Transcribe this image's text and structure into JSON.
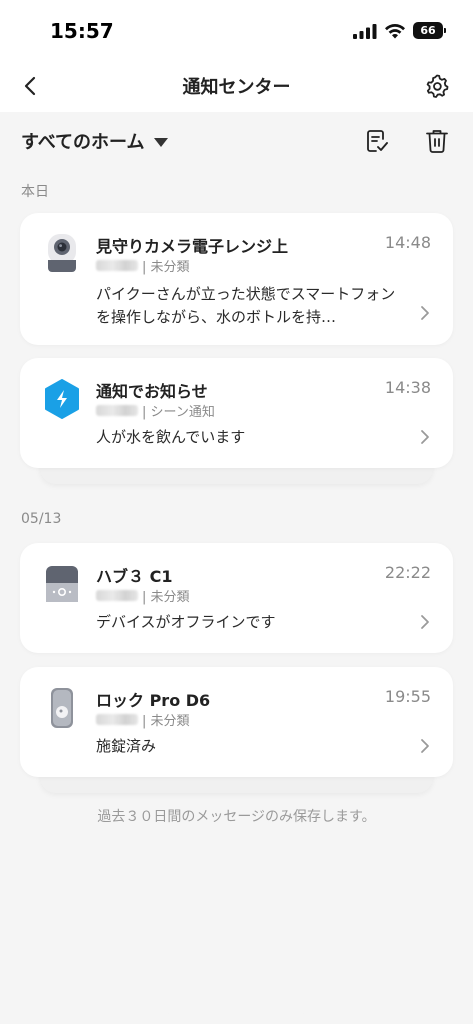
{
  "status_bar": {
    "time": "15:57",
    "battery": "66"
  },
  "nav": {
    "title": "通知センター"
  },
  "toolbar": {
    "home_filter": "すべてのホーム"
  },
  "sections": [
    {
      "label": "本日",
      "cards": [
        {
          "title": "見守りカメラ電子レンジ上",
          "time": "14:48",
          "subtitle": "| 未分類",
          "body": "パイクーさんが立った状態でスマートフォンを操作しながら、水のボトルを持…",
          "icon": "camera-icon"
        },
        {
          "title": "通知でお知らせ",
          "time": "14:38",
          "subtitle": "| シーン通知",
          "body": "人が水を飲んでいます",
          "icon": "scene-bolt-icon"
        }
      ]
    },
    {
      "label": "05/13",
      "cards": [
        {
          "title": "ハブ３ C1",
          "time": "22:22",
          "subtitle": "| 未分類",
          "body": "デバイスがオフラインです",
          "icon": "hub-icon"
        },
        {
          "title": "ロック Pro D6",
          "time": "19:55",
          "subtitle": "| 未分類",
          "body": "施錠済み",
          "icon": "lock-icon"
        }
      ]
    }
  ],
  "footer": {
    "note": "過去３０日間のメッセージのみ保存します。"
  },
  "colors": {
    "accent": "#1aa0e6",
    "background": "#f5f5f5",
    "card": "#ffffff",
    "muted": "#8a8a8a"
  }
}
